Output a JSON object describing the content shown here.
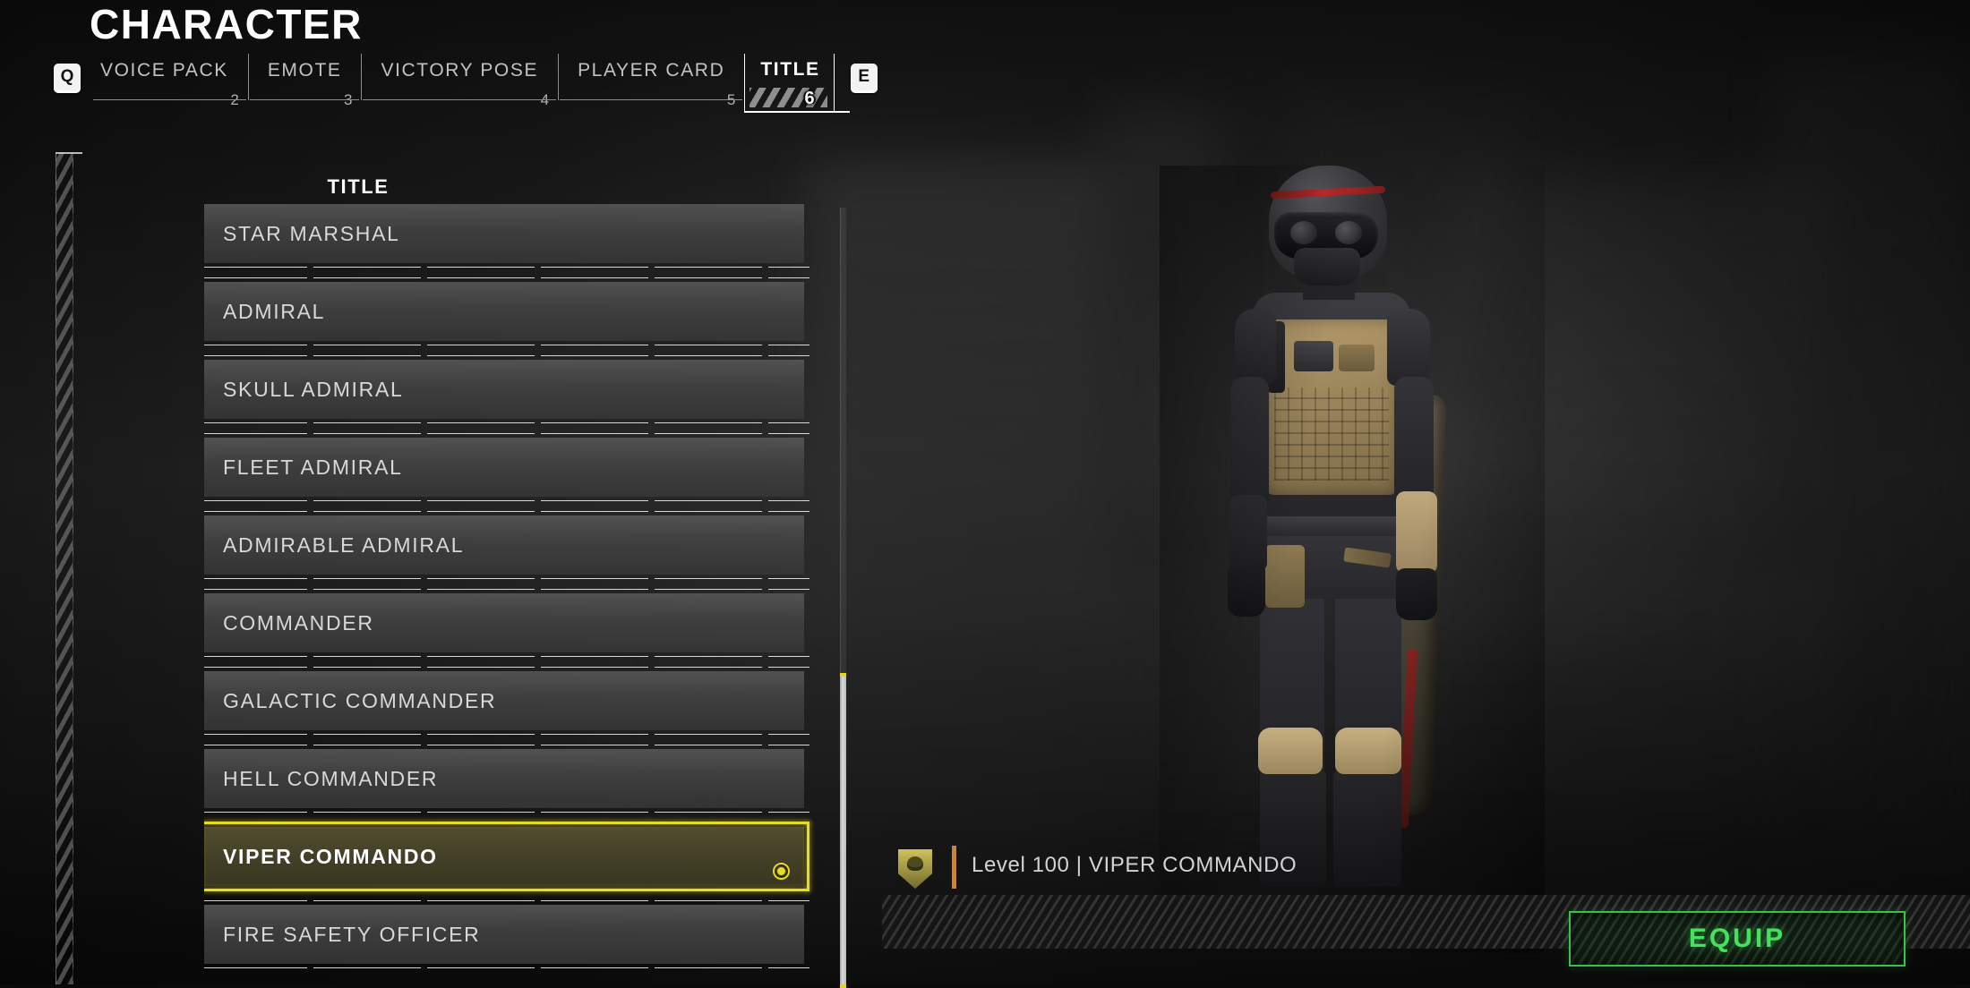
{
  "header": {
    "page_title": "CHARACTER",
    "left_key": "Q",
    "right_key": "E"
  },
  "tabs": [
    {
      "label": "VOICE PACK",
      "number": "2",
      "active": false
    },
    {
      "label": "EMOTE",
      "number": "3",
      "active": false
    },
    {
      "label": "VICTORY POSE",
      "number": "4",
      "active": false
    },
    {
      "label": "PLAYER CARD",
      "number": "5",
      "active": false
    },
    {
      "label": "TITLE",
      "number": "6",
      "active": true
    }
  ],
  "list": {
    "header": "TITLE",
    "items": [
      {
        "label": "STAR MARSHAL",
        "selected": false,
        "equipped": false
      },
      {
        "label": "ADMIRAL",
        "selected": false,
        "equipped": false
      },
      {
        "label": "SKULL ADMIRAL",
        "selected": false,
        "equipped": false
      },
      {
        "label": "FLEET ADMIRAL",
        "selected": false,
        "equipped": false
      },
      {
        "label": "ADMIRABLE ADMIRAL",
        "selected": false,
        "equipped": false
      },
      {
        "label": "COMMANDER",
        "selected": false,
        "equipped": false
      },
      {
        "label": "GALACTIC COMMANDER",
        "selected": false,
        "equipped": false
      },
      {
        "label": "HELL COMMANDER",
        "selected": false,
        "equipped": false
      },
      {
        "label": "VIPER COMMANDO",
        "selected": true,
        "equipped": true
      },
      {
        "label": "FIRE SAFETY OFFICER",
        "selected": false,
        "equipped": false
      }
    ]
  },
  "info": {
    "level_line": "Level 100 | VIPER COMMANDO",
    "badge_icon": "skull-shield-icon"
  },
  "actions": {
    "equip_label": "EQUIP"
  },
  "colors": {
    "selection_yellow": "#e8dc1e",
    "equip_green": "#35c44a",
    "accent_orange": "#d9812a",
    "panel_gray": "#565656"
  }
}
